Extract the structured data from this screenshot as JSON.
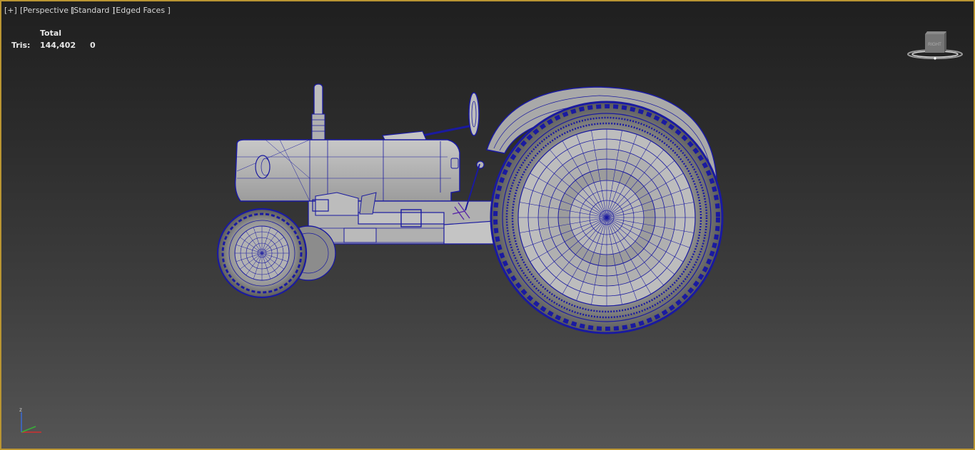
{
  "viewport": {
    "labels": {
      "plus": "[+]",
      "perspective": "[Perspective ]",
      "shading": "[Standard ]",
      "edged": "[Edged Faces ]"
    },
    "stats": {
      "header": "Total",
      "tris_label": "Tris:",
      "tris_total": "144,402",
      "tris_selected": "0"
    },
    "viewcube": {
      "face": "RIGHT"
    },
    "axis": {
      "z": "z"
    },
    "colors": {
      "border": "#b99532",
      "wire": "#1a1aa0"
    }
  }
}
